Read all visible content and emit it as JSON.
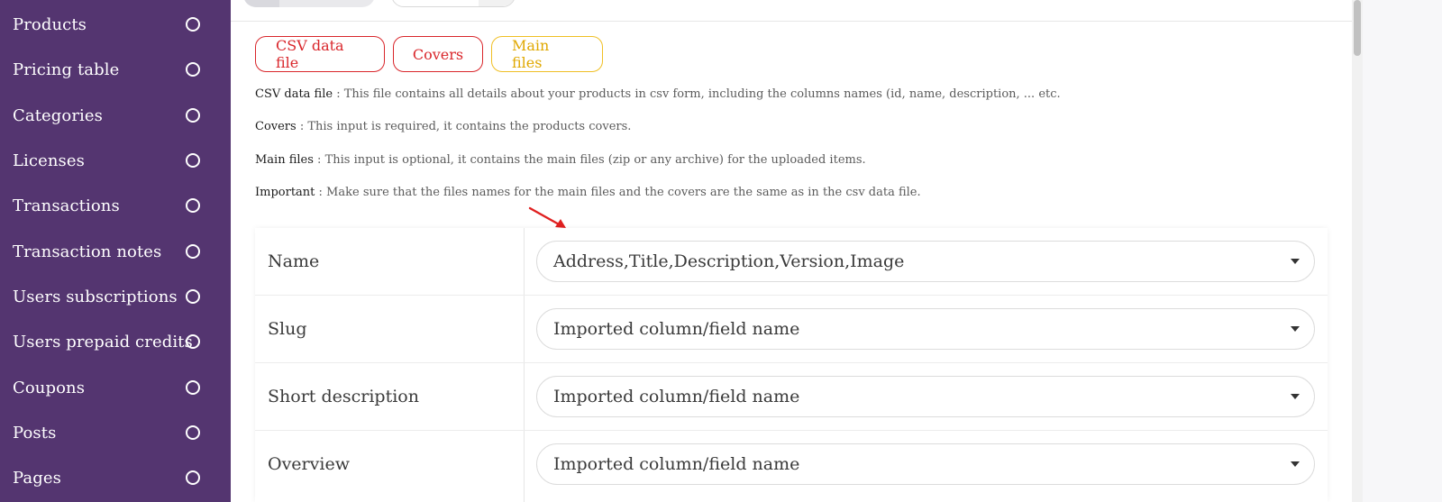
{
  "sidebar": {
    "items": [
      {
        "label": "Products"
      },
      {
        "label": "Pricing table"
      },
      {
        "label": "Categories"
      },
      {
        "label": "Licenses"
      },
      {
        "label": "Transactions"
      },
      {
        "label": "Transaction notes"
      },
      {
        "label": "Users subscriptions"
      },
      {
        "label": "Users prepaid credits"
      },
      {
        "label": "Coupons"
      },
      {
        "label": "Posts"
      },
      {
        "label": "Pages"
      }
    ]
  },
  "tabs": [
    {
      "label": "CSV data file"
    },
    {
      "label": "Covers"
    },
    {
      "label": "Main files"
    }
  ],
  "info": [
    {
      "term": "CSV data file",
      "text": " : This file contains all details about your products in csv form, including the columns names (id, name, description, ... etc."
    },
    {
      "term": "Covers",
      "text": " : This input is required, it contains the products covers."
    },
    {
      "term": "Main files",
      "text": " : This input is optional, it contains the main files (zip or any archive) for the uploaded items."
    },
    {
      "term": "Important",
      "text": " : Make sure that the files names for the main files and the covers are the same as in the csv data file."
    }
  ],
  "mapping": [
    {
      "field": "Name",
      "value": "Address,Title,Description,Version,Image"
    },
    {
      "field": "Slug",
      "value": "Imported column/field name"
    },
    {
      "field": "Short description",
      "value": "Imported column/field name"
    },
    {
      "field": "Overview",
      "value": "Imported column/field name"
    }
  ],
  "colors": {
    "sidebar_bg": "#543570",
    "tab_red": "#d9262b",
    "tab_yellow": "#f0bf24",
    "annotation_arrow": "#e02020"
  }
}
